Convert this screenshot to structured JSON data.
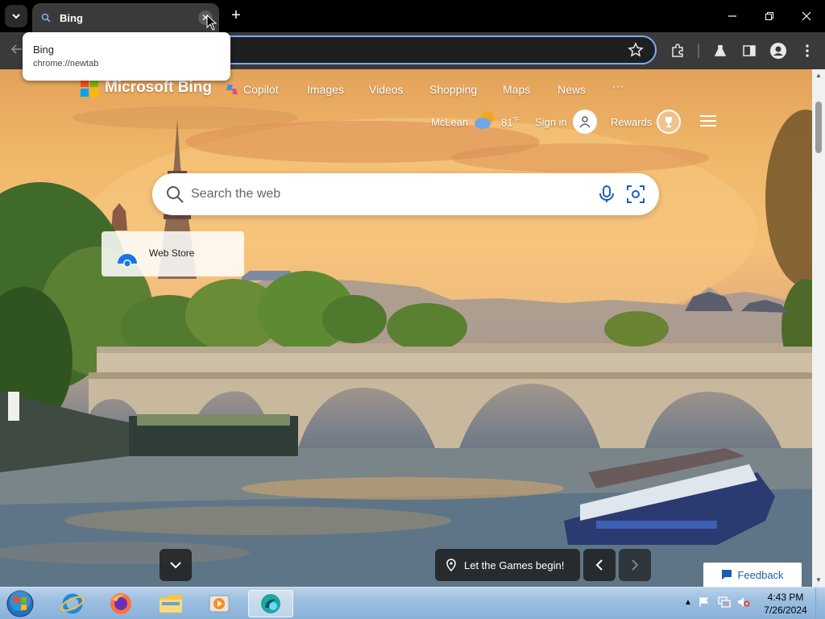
{
  "browser": {
    "tab": {
      "title": "Bing",
      "close": "✕"
    },
    "tooltip": {
      "title": "Bing",
      "url": "chrome://newtab"
    },
    "new_tab": "+"
  },
  "bing": {
    "logo_text": "Microsoft Bing",
    "nav": [
      {
        "label": "Copilot"
      },
      {
        "label": "Images"
      },
      {
        "label": "Videos"
      },
      {
        "label": "Shopping"
      },
      {
        "label": "Maps"
      },
      {
        "label": "News"
      },
      {
        "label": "···"
      }
    ],
    "weather": {
      "location": "McLean",
      "temp": "81",
      "unit": "°F"
    },
    "sign_in": "Sign in",
    "rewards": "Rewards",
    "search": {
      "placeholder": "Search the web"
    },
    "tile": {
      "label": "Web Store"
    },
    "caption": "Let the Games begin!",
    "feedback": "Feedback"
  },
  "taskbar": {
    "time": "4:43 PM",
    "date": "7/26/2024"
  },
  "colors": {
    "accent": "#7cacf8",
    "ms_red": "#f25022",
    "ms_green": "#7fba00",
    "ms_blue": "#00a4ef",
    "ms_yellow": "#ffb900"
  }
}
